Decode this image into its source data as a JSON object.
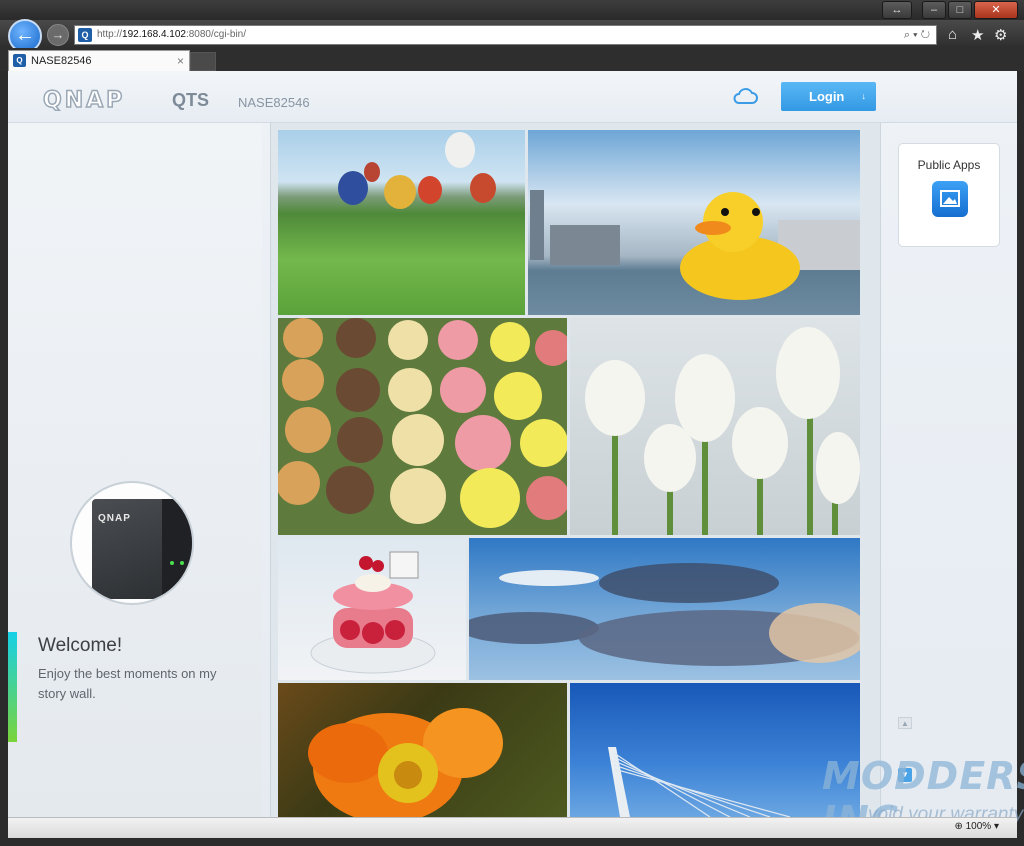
{
  "browser": {
    "url_prefix": "http://",
    "url_host": "192.168.4.102",
    "url_rest": ":8080/cgi-bin/",
    "tab_title": "NASE82546",
    "tab_close": "×",
    "zoom": "100%",
    "back_icon": "back-arrow-icon",
    "forward_icon": "forward-arrow-icon"
  },
  "header": {
    "logo": "QNAP",
    "product": "QTS",
    "device_name": "NASE82546",
    "login_label": "Login",
    "login_arrow": "↓",
    "accent_color": "#3399e4"
  },
  "welcome": {
    "title": "Welcome!",
    "subtitle": "Enjoy the best moments on my story wall."
  },
  "device_image": {
    "brand": "QNAP"
  },
  "public_apps": {
    "label": "Public Apps",
    "icon": "photo-station-icon"
  },
  "story_wall": {
    "photos": [
      "hot-air-balloons",
      "rubber-duck-harbor",
      "macarons",
      "white-tulips",
      "macaron-dessert",
      "blue-sky-clouds",
      "orange-poppy",
      "cable-bridge"
    ]
  },
  "watermark": {
    "main": "MODDERS INC.",
    "sub": "void your warranty"
  }
}
